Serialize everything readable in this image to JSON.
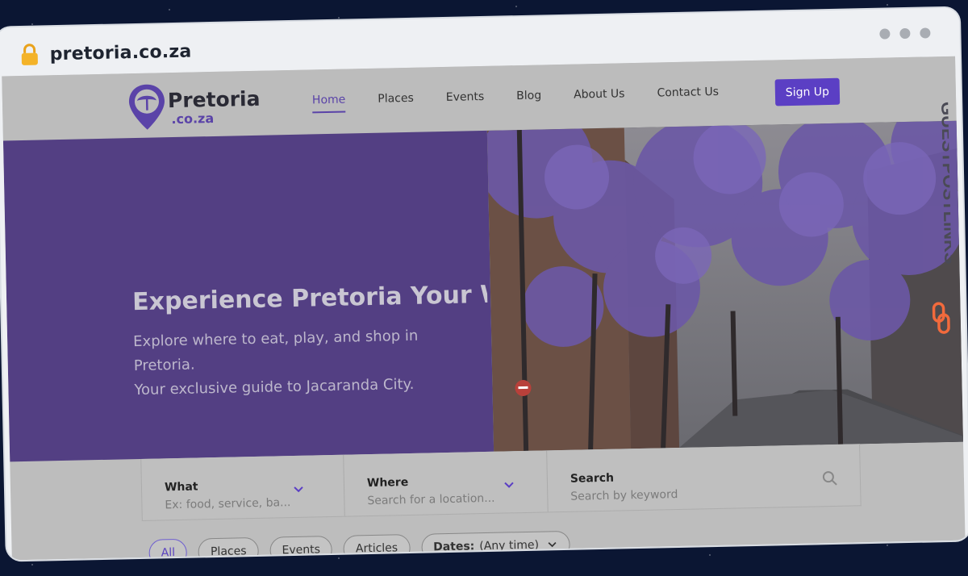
{
  "browser": {
    "url": "pretoria.co.za"
  },
  "site": {
    "logo_name": "Pretoria",
    "logo_sub": ".co.za",
    "nav": [
      "Home",
      "Places",
      "Events",
      "Blog",
      "About Us",
      "Contact Us"
    ],
    "active_nav": "Home",
    "signup_label": "Sign Up"
  },
  "hero": {
    "title": "Experience Pretoria Your Wa",
    "subtitle_line1": "Explore where to eat, play, and shop in Pretoria.",
    "subtitle_line2": "Your exclusive guide to Jacaranda City."
  },
  "search": {
    "what_label": "What",
    "what_placeholder": "Ex: food, service, ba...",
    "where_label": "Where",
    "where_placeholder": "Search for a location...",
    "search_label": "Search",
    "search_placeholder": "Search by keyword"
  },
  "filters": {
    "items": [
      "All",
      "Places",
      "Events",
      "Articles"
    ],
    "active": "All",
    "dates_label": "Dates:",
    "dates_value": "(Any time)"
  },
  "watermark": {
    "text": "GUESTPOSTLINKS"
  },
  "colors": {
    "brand_purple": "#5b3fc4",
    "hero_purple": "#533f83",
    "overlay_gray": "#bcbcbc",
    "watermark_orange": "#f26a3c"
  }
}
